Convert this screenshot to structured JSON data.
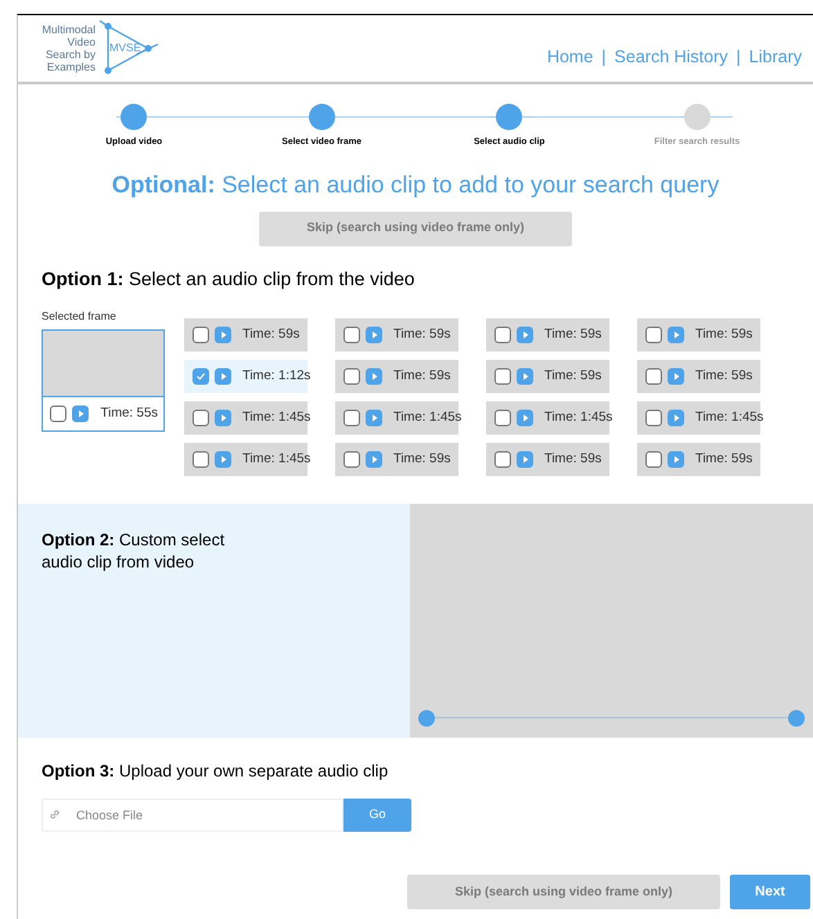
{
  "logo": {
    "caption": "Multimodal Video Search by Examples",
    "mark": "MVSE"
  },
  "nav": [
    {
      "label": "Home"
    },
    {
      "label": "Search History"
    },
    {
      "label": "Library"
    }
  ],
  "nav_separator": "|",
  "steps": [
    {
      "label": "Upload video",
      "completed": true
    },
    {
      "label": "Select video frame",
      "completed": true
    },
    {
      "label": "Select audio clip",
      "completed": true
    },
    {
      "label": "Filter search results",
      "completed": false
    }
  ],
  "heading": "**Optional:** Select an audio clip to add to your search query",
  "skip_top": {
    "label": "Skip (search using video frame only)",
    "disabled": true
  },
  "option1": {
    "title": "**Option 1:** Select an audio clip from the video",
    "selected_frame_label": "Selected frame",
    "selected_frame": {
      "time": "Time: 55s",
      "checked": false
    },
    "clips": [
      {
        "time": "Time: 59s",
        "checked": false
      },
      {
        "time": "Time: 59s",
        "checked": false
      },
      {
        "time": "Time: 59s",
        "checked": false
      },
      {
        "time": "Time: 59s",
        "checked": false
      },
      {
        "time": "Time: 1:12s",
        "checked": true
      },
      {
        "time": "Time: 59s",
        "checked": false
      },
      {
        "time": "Time: 59s",
        "checked": false
      },
      {
        "time": "Time: 59s",
        "checked": false
      },
      {
        "time": "Time: 1:45s",
        "checked": false
      },
      {
        "time": "Time: 1:45s",
        "checked": false
      },
      {
        "time": "Time: 1:45s",
        "checked": false
      },
      {
        "time": "Time: 1:45s",
        "checked": false
      },
      {
        "time": "Time: 1:45s",
        "checked": false
      },
      {
        "time": "Time: 59s",
        "checked": false
      },
      {
        "time": "Time: 59s",
        "checked": false
      },
      {
        "time": "Time: 59s",
        "checked": false
      }
    ]
  },
  "option2": {
    "title": "**Option 2:** Custom select audio clip from video",
    "handles": [
      {
        "level": 0
      },
      {
        "level": 1
      }
    ]
  },
  "option3": {
    "title": "**Option 3:** Upload your own separate audio clip",
    "placeholder": "Choose File",
    "go": "Go"
  },
  "footer": {
    "skip": {
      "label": "Skip (search using video frame only)",
      "disabled": true
    },
    "next": "Next"
  }
}
